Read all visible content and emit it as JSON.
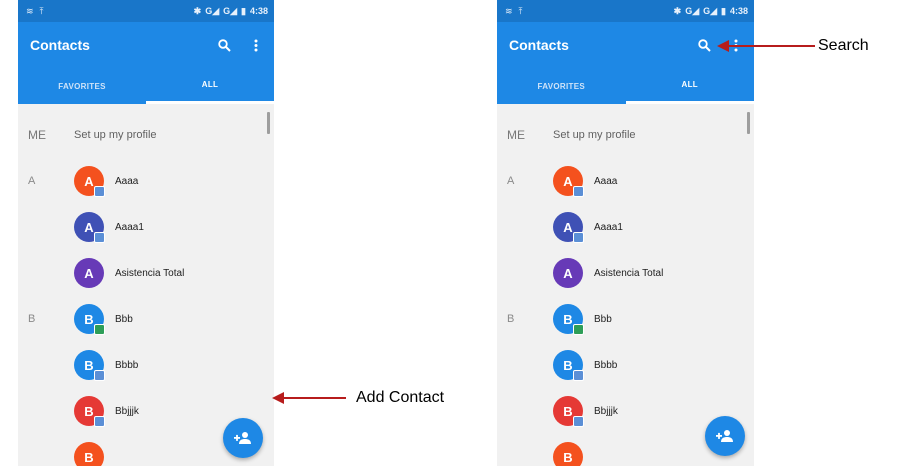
{
  "status": {
    "time": "4:38",
    "network": "G G"
  },
  "toolbar": {
    "title": "Contacts"
  },
  "tabs": [
    {
      "label": "FAVORITES",
      "active": false
    },
    {
      "label": "ALL",
      "active": true
    }
  ],
  "profile": {
    "section": "ME",
    "label": "Set up my profile"
  },
  "contacts": [
    {
      "section": "A",
      "initial": "A",
      "name": "Aaaa",
      "color": "#f4511e",
      "badge": "blue"
    },
    {
      "section": "",
      "initial": "A",
      "name": "Aaaa1",
      "color": "#3f51b5",
      "badge": "blue"
    },
    {
      "section": "",
      "initial": "A",
      "name": "Asistencia Total",
      "color": "#673ab7",
      "badge": ""
    },
    {
      "section": "B",
      "initial": "B",
      "name": "Bbb",
      "color": "#1e88e5",
      "badge": "green"
    },
    {
      "section": "",
      "initial": "B",
      "name": "Bbbb",
      "color": "#1e88e5",
      "badge": "blue"
    },
    {
      "section": "",
      "initial": "B",
      "name": "Bbjjjk",
      "color": "#e53935",
      "badge": "blue"
    },
    {
      "section": "",
      "initial": "B",
      "name": "",
      "color": "#f4511e",
      "badge": ""
    }
  ],
  "annotations": {
    "add_contact": "Add Contact",
    "search": "Search"
  },
  "icons": {
    "search": "search-icon",
    "more": "more-vert-icon",
    "add_contact": "person-add-icon"
  },
  "colors": {
    "primary": "#1e88e5",
    "status_bar": "#1976c9",
    "arrow": "#b71c1c"
  }
}
